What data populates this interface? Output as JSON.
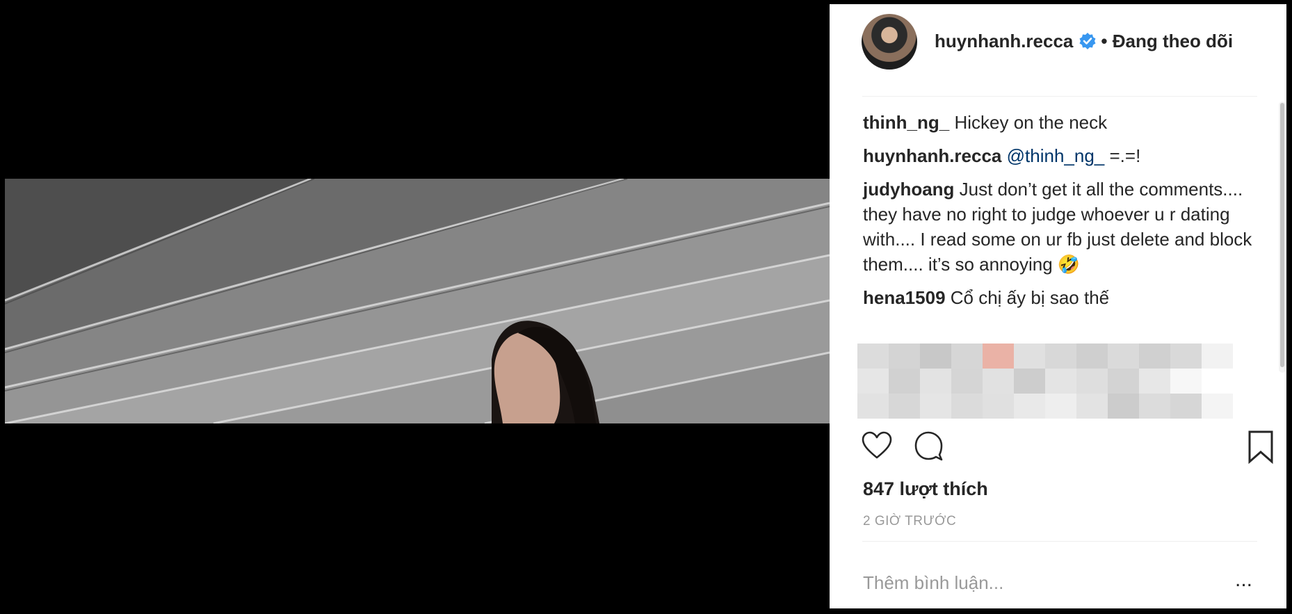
{
  "post": {
    "author": "huynhanh.recca",
    "follow_status": "• Đang theo dõi",
    "likes": "847 lượt thích",
    "time_ago": "2 GIỜ TRƯỚC",
    "comment_placeholder": "Thêm bình luận...",
    "more_label": "..."
  },
  "comments": [
    {
      "user": "thinh_ng_",
      "mention": "",
      "text": "Hickey on the neck"
    },
    {
      "user": "huynhanh.recca",
      "mention": "@thinh_ng_",
      "text": "=.=!"
    },
    {
      "user": "judyhoang",
      "mention": "",
      "text": "Just don’t get it all the comments.... they have no right to judge whoever u r dating with.... I read some on ur fb just delete and block them.... it’s so annoying 🤣"
    },
    {
      "user": "hena1509",
      "mention": "",
      "text": "Cổ chị ấy bị sao thế"
    }
  ],
  "icons": {
    "like": "heart-icon",
    "comment": "comment-bubble-icon",
    "save": "bookmark-icon",
    "verified": "verified-badge-icon",
    "more": "more-options-icon"
  },
  "colors": {
    "verified": "#3897f0",
    "mention": "#003569",
    "text": "#262626",
    "muted": "#999999"
  }
}
